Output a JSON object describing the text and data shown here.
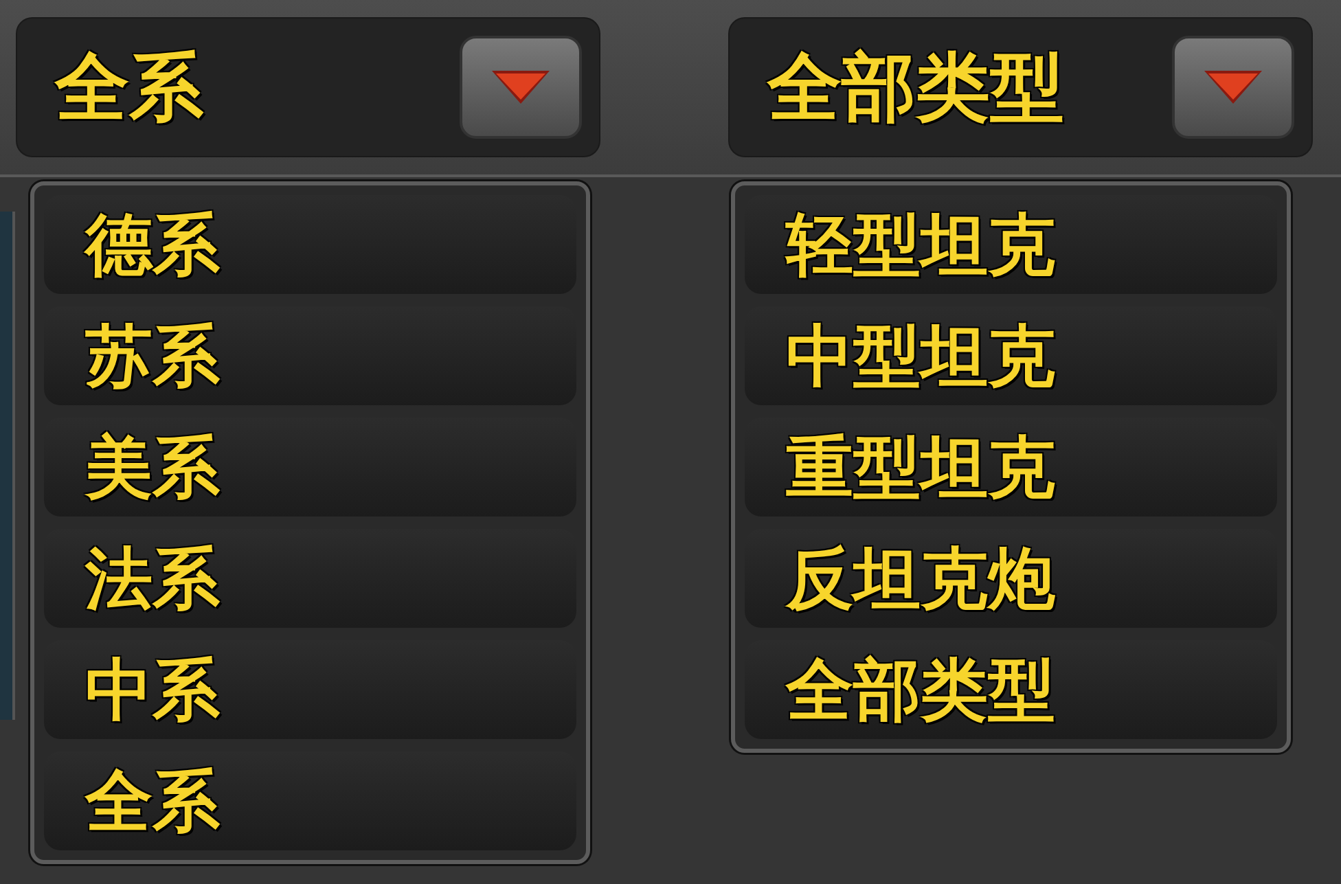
{
  "filters": [
    {
      "value": "全系",
      "expanded": true,
      "options": [
        {
          "label": "德系"
        },
        {
          "label": "苏系"
        },
        {
          "label": "美系"
        },
        {
          "label": "法系"
        },
        {
          "label": "中系"
        },
        {
          "label": "全系"
        }
      ]
    },
    {
      "value": "全部类型",
      "expanded": true,
      "options": [
        {
          "label": "轻型坦克"
        },
        {
          "label": "中型坦克"
        },
        {
          "label": "重型坦克"
        },
        {
          "label": "反坦克炮"
        },
        {
          "label": "全部类型"
        }
      ]
    }
  ]
}
